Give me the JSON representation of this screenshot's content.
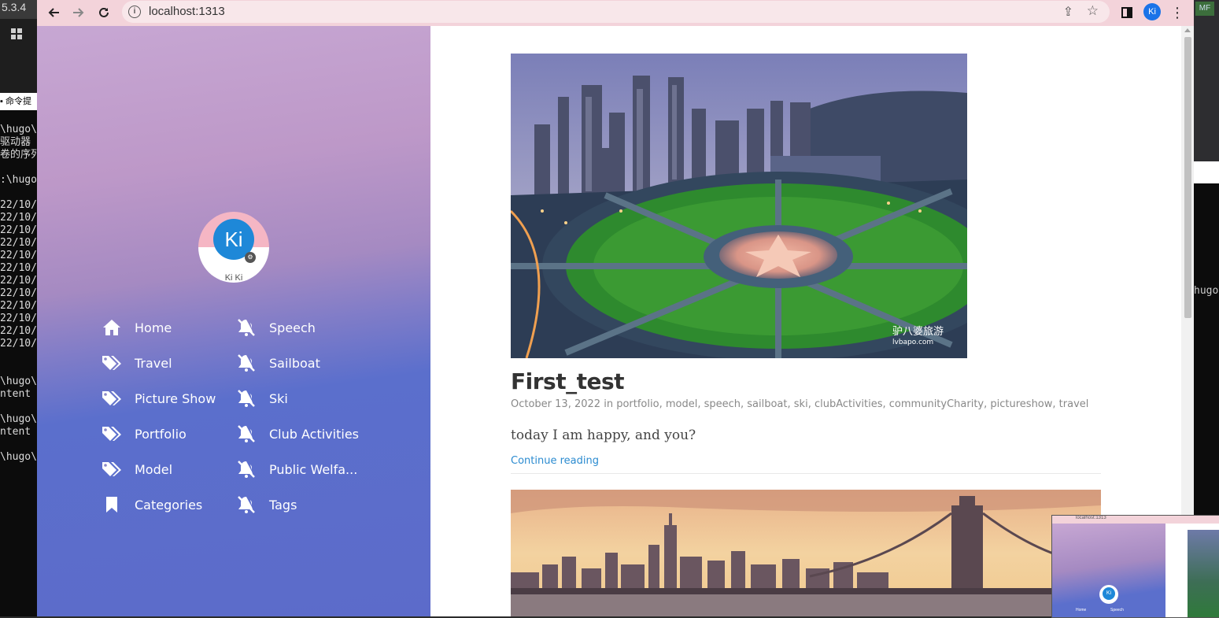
{
  "desktop": {
    "left_version": "5.3.4",
    "cmd_window_title": "命令提",
    "terminal_lines": [
      "\\hugo\\",
      "驱动器",
      "卷的序列",
      "",
      ":\\hugo",
      "",
      "22/10/",
      "22/10/",
      "22/10/",
      "22/10/",
      "22/10/",
      "22/10/",
      "22/10/",
      "22/10/",
      "22/10/",
      "22/10/",
      "22/10/",
      "22/10/",
      "",
      "",
      "\\hugo\\",
      "ntent",
      "",
      "\\hugo\\",
      "ntent",
      "",
      "\\hugo\\"
    ],
    "right_terminal_text": "hugo"
  },
  "browser": {
    "url": "localhost:1313",
    "profile_initials": "Ki"
  },
  "sidebar": {
    "avatar_initials": "Ki",
    "avatar_name": "Ki Ki",
    "menu_left": [
      {
        "label": "Home",
        "icon": "home-icon"
      },
      {
        "label": "Travel",
        "icon": "tags-icon"
      },
      {
        "label": "Picture Show",
        "icon": "tags-icon"
      },
      {
        "label": "Portfolio",
        "icon": "tags-icon"
      },
      {
        "label": "Model",
        "icon": "tags-icon"
      },
      {
        "label": "Categories",
        "icon": "bookmark-icon"
      }
    ],
    "menu_right": [
      {
        "label": "Speech",
        "icon": "bell-slash-icon"
      },
      {
        "label": "Sailboat",
        "icon": "bell-slash-icon"
      },
      {
        "label": "Ski",
        "icon": "bell-slash-icon"
      },
      {
        "label": "Club Activities",
        "icon": "bell-slash-icon"
      },
      {
        "label": "Public Welfa...",
        "icon": "bell-slash-icon"
      },
      {
        "label": "Tags",
        "icon": "bell-slash-icon"
      }
    ]
  },
  "post": {
    "title": "First_test",
    "date": "October 13, 2022",
    "in_word": "in",
    "tags": [
      "portfolio",
      "model",
      "speech",
      "sailboat",
      "ski",
      "clubActivities",
      "communityCharity",
      "pictureshow",
      "travel"
    ],
    "excerpt": "today I am happy, and you?",
    "continue_label": "Continue reading",
    "image_watermark": "驴八婆旅游",
    "image_watermark_url": "lvbapo.com"
  },
  "thumbnail": {
    "url": "localhost:1313",
    "menu": [
      "Home",
      "Speech"
    ]
  },
  "colors": {
    "accent_link": "#2b8bd0",
    "avatar_blue": "#1e88d8",
    "toolbar_pink": "#f3d3da"
  }
}
